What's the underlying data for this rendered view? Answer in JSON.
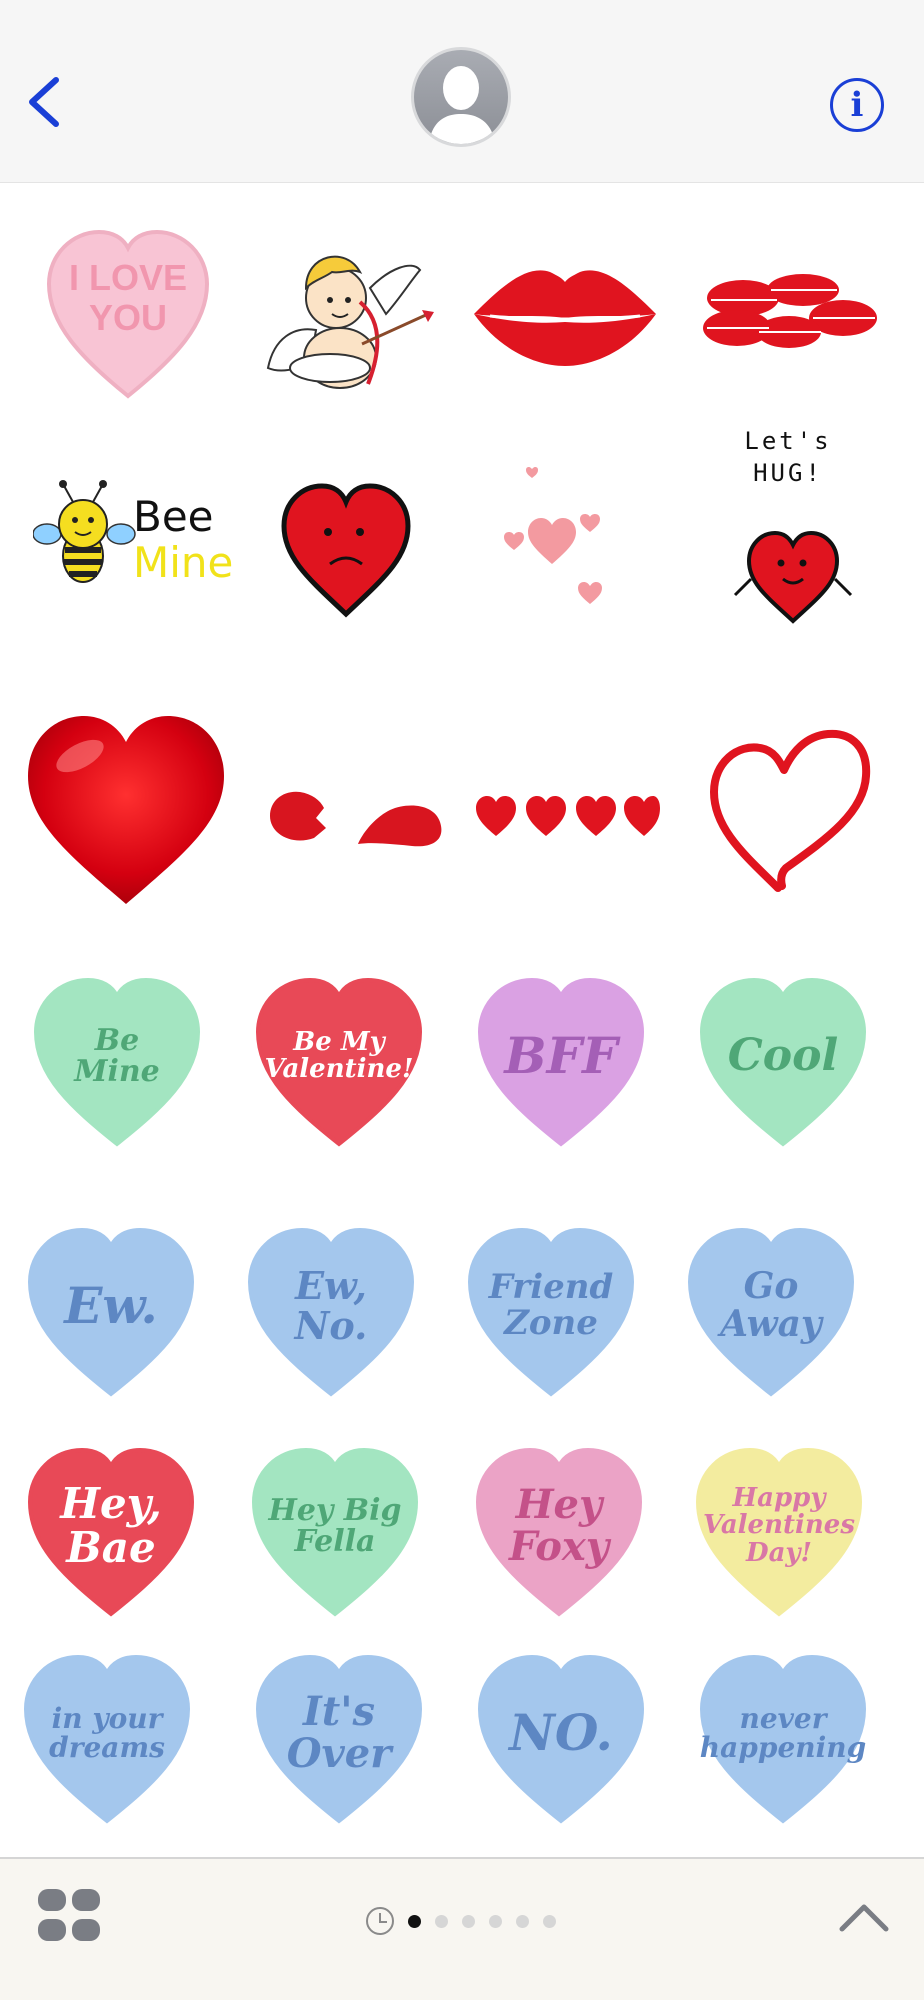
{
  "header": {
    "back_icon": "chevron-left-icon",
    "avatar_icon": "person-silhouette-icon",
    "info_label": "i",
    "accent_color": "#1a3fd6"
  },
  "stickers": {
    "row1": {
      "candy_love": "I LOVE\nYOU",
      "cupid": "cupid",
      "lips": "lips",
      "kisses": "kisses"
    },
    "row2": {
      "bee_word1": "Bee",
      "bee_word2": "Mine",
      "sad_heart": "sad-heart",
      "hearts": "floating-hearts",
      "hug_label": "Let's\nHUG!"
    },
    "row3": {
      "big_heart": "big-red-heart",
      "broken_heart": "broken-heart",
      "four_hearts": "four-hearts",
      "outline_heart": "outline-heart"
    },
    "candy_hearts": [
      {
        "text": "Be Mine",
        "fill": "#a8ecc7",
        "ink": "#4fa777"
      },
      {
        "text": "Be My\nValentine!",
        "fill": "#ef4b5a",
        "ink": "#ffffff"
      },
      {
        "text": "BFF",
        "fill": "#e1a6ea",
        "ink": "#a45fb6"
      },
      {
        "text": "Cool",
        "fill": "#a8ecc7",
        "ink": "#4fa777"
      },
      {
        "text": "Ew.",
        "fill": "#a9cdf4",
        "ink": "#5d87c3"
      },
      {
        "text": "Ew,\nNo.",
        "fill": "#a9cdf4",
        "ink": "#5d87c3"
      },
      {
        "text": "Friend\nZone",
        "fill": "#a9cdf4",
        "ink": "#5d87c3"
      },
      {
        "text": "Go\nAway",
        "fill": "#a9cdf4",
        "ink": "#5d87c3"
      },
      {
        "text": "Hey,\nBae",
        "fill": "#ef4b5a",
        "ink": "#ffffff"
      },
      {
        "text": "Hey Big\nFella",
        "fill": "#a8ecc7",
        "ink": "#4fa777"
      },
      {
        "text": "Hey\nFoxy",
        "fill": "#f2a8cc",
        "ink": "#c45189"
      },
      {
        "text": "Happy\nValentines\nDay!",
        "fill": "#fbf3a4",
        "ink": "#d977a6"
      },
      {
        "text": "in your\ndreams",
        "fill": "#a9cdf4",
        "ink": "#5d87c3"
      },
      {
        "text": "It's\nOver",
        "fill": "#a9cdf4",
        "ink": "#5d87c3"
      },
      {
        "text": "NO.",
        "fill": "#a9cdf4",
        "ink": "#5d87c3"
      },
      {
        "text": "never\nhappening",
        "fill": "#a9cdf4",
        "ink": "#5d87c3"
      }
    ]
  },
  "bottom_bar": {
    "apps_icon": "app-grid-icon",
    "recents_icon": "clock-icon",
    "page_count": 6,
    "active_page": 1,
    "expand_icon": "chevron-up-icon"
  }
}
